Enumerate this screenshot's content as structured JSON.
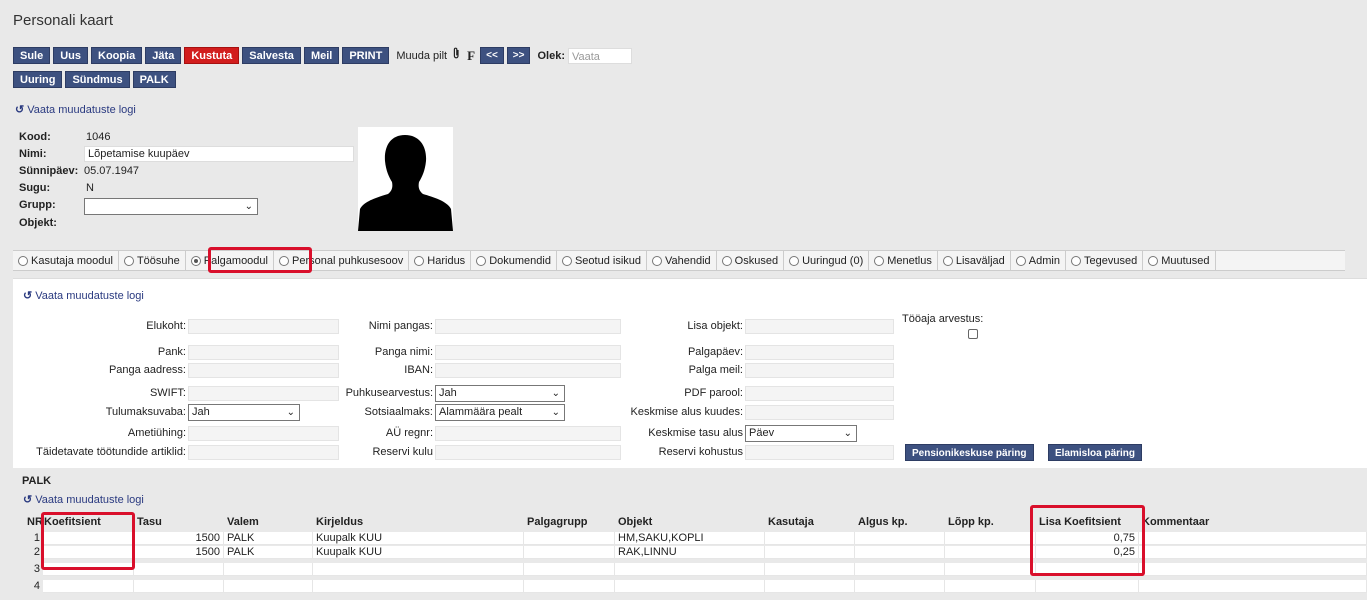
{
  "page": {
    "title": "Personali kaart"
  },
  "toolbar": {
    "row1": [
      "Sule",
      "Uus",
      "Koopia",
      "Jäta",
      "Kustuta",
      "Salvesta",
      "Meil",
      "PRINT"
    ],
    "muuda_pilt": "Muuda pilt",
    "clip_icon": "paperclip-icon",
    "f_label": "F",
    "prev": "<<",
    "next": ">>",
    "olek_label": "Olek:",
    "olek_value": "Vaata",
    "row2": [
      "Uuring",
      "Sündmus",
      "PALK"
    ]
  },
  "log_link": "Vaata muudatuste logi",
  "person": {
    "kood_label": "Kood:",
    "kood": "1046",
    "nimi_label": "Nimi:",
    "nimi": "Lõpetamise kuupäev",
    "synni_label": "Sünnipäev:",
    "synni": "05.07.1947",
    "sugu_label": "Sugu:",
    "sugu": "N",
    "grupp_label": "Grupp:",
    "grupp": "",
    "objekt_label": "Objekt:"
  },
  "tabs": [
    {
      "label": "Kasutaja moodul",
      "active": false
    },
    {
      "label": "Töösuhe",
      "active": false
    },
    {
      "label": "Palgamoodul",
      "active": true
    },
    {
      "label": "Personal puhkusesoov",
      "active": false
    },
    {
      "label": "Haridus",
      "active": false
    },
    {
      "label": "Dokumendid",
      "active": false
    },
    {
      "label": "Seotud isikud",
      "active": false
    },
    {
      "label": "Vahendid",
      "active": false
    },
    {
      "label": "Oskused",
      "active": false
    },
    {
      "label": "Uuringud (0)",
      "active": false
    },
    {
      "label": "Menetlus",
      "active": false
    },
    {
      "label": "Lisaväljad",
      "active": false
    },
    {
      "label": "Admin",
      "active": false
    },
    {
      "label": "Tegevused",
      "active": false
    },
    {
      "label": "Muutused",
      "active": false
    }
  ],
  "form": {
    "elukoht": "Elukoht:",
    "nimi_pangas": "Nimi pangas:",
    "lisa_objekt": "Lisa objekt:",
    "tooaja": "Tööaja arvestus:",
    "pank": "Pank:",
    "panga_nimi": "Panga nimi:",
    "palgapaev": "Palgapäev:",
    "panga_aadress": "Panga aadress:",
    "iban": "IBAN:",
    "palga_meil": "Palga meil:",
    "swift": "SWIFT:",
    "puhkusearvestus": "Puhkusearvestus:",
    "puhkusearvestus_value": "Jah",
    "pdf_parool": "PDF parool:",
    "tulumaksuvaba": "Tulumaksuvaba:",
    "tulumaksuvaba_value": "Jah",
    "sotsiaalmaks": "Sotsiaalmaks:",
    "sotsiaalmaks_value": "Alammäära pealt",
    "keskmise_alus": "Keskmise alus kuudes:",
    "ametiyhing": "Ametiühing:",
    "au_regnr": "AÜ regnr:",
    "keskmise_tasu": "Keskmise tasu alus",
    "keskmise_tasu_value": "Päev",
    "taidetavate": "Täidetavate töötundide artiklid:",
    "reservi_kulu": "Reservi kulu",
    "reservi_kohustus": "Reservi kohustus",
    "pension_btn": "Pensionikeskuse päring",
    "elamisloa_btn": "Elamisloa päring"
  },
  "palk": {
    "title": "PALK",
    "columns": [
      "NR",
      "Koefitsient",
      "Tasu",
      "Valem",
      "Kirjeldus",
      "Palgagrupp",
      "Objekt",
      "Kasutaja",
      "Algus kp.",
      "Lõpp kp.",
      "Lisa Koefitsient",
      "Kommentaar"
    ],
    "rows": [
      {
        "nr": "1",
        "koef": "",
        "tasu": "1500",
        "valem": "PALK",
        "kirjeldus": "Kuupalk KUU",
        "palgagrupp": "",
        "objekt": "HM,SAKU,KOPLI",
        "kasutaja": "",
        "algus": "",
        "lopp": "",
        "lisa": "0,75",
        "kommentaar": ""
      },
      {
        "nr": "2",
        "koef": "",
        "tasu": "1500",
        "valem": "PALK",
        "kirjeldus": "Kuupalk KUU",
        "palgagrupp": "",
        "objekt": "RAK,LINNU",
        "kasutaja": "",
        "algus": "",
        "lopp": "",
        "lisa": "0,25",
        "kommentaar": ""
      },
      {
        "nr": "3",
        "koef": "",
        "tasu": "",
        "valem": "",
        "kirjeldus": "",
        "palgagrupp": "",
        "objekt": "",
        "kasutaja": "",
        "algus": "",
        "lopp": "",
        "lisa": "",
        "kommentaar": ""
      },
      {
        "nr": "4",
        "koef": "",
        "tasu": "",
        "valem": "",
        "kirjeldus": "",
        "palgagrupp": "",
        "objekt": "",
        "kasutaja": "",
        "algus": "",
        "lopp": "",
        "lisa": "",
        "kommentaar": ""
      }
    ]
  },
  "colors": {
    "button": "#3d5180",
    "danger": "#d21d1d",
    "highlight": "#d90f2b"
  }
}
